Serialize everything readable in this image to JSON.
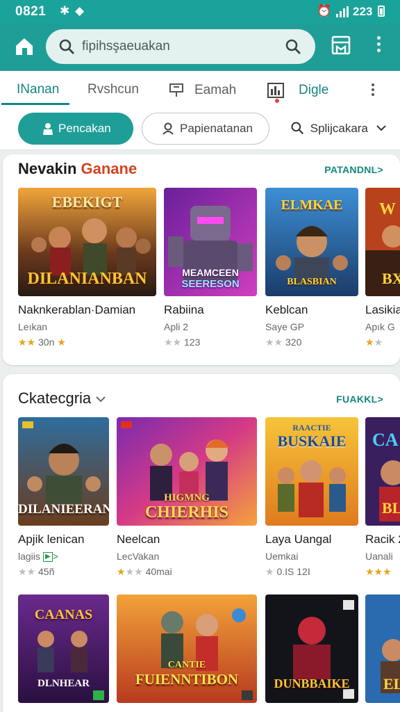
{
  "status_bar": {
    "time": "0821",
    "battery_text": "2̶2̶3̶",
    "battery": "223"
  },
  "search": {
    "placeholder": "fipihsşaeuakan"
  },
  "tabs": [
    {
      "label": "INanan",
      "active": true
    },
    {
      "label": "Rvshcun"
    },
    {
      "label": "Eamah"
    },
    {
      "label": "Digle"
    }
  ],
  "filters": {
    "primary": "Pencakan",
    "secondary": "Papienatanan",
    "dropdown": "Splijcakara"
  },
  "section1": {
    "title_main": "Nevakin",
    "title_accent": "Ganane",
    "link": "PATANDNL>",
    "games": [
      {
        "name": "Naknkerablan·Damian",
        "sub": "Leıkan",
        "rating": "30n",
        "stars_on": 2,
        "art": "DILANIANBAN",
        "art_top": "EBEKIGT"
      },
      {
        "name": "Rabiina",
        "sub": "Apli 2",
        "rating": "123",
        "stars_on": 0,
        "art": "SEERESON",
        "art_top": "MEAMCEEN"
      },
      {
        "name": "Keblcan",
        "sub": "Saye GP",
        "rating": "320",
        "stars_on": 0,
        "art": "BLASBIAN",
        "art_top": "ELMKAE"
      },
      {
        "name": "Lasikia",
        "sub": "Apık G",
        "rating": "",
        "stars_on": 1,
        "art": "BX",
        "art_top": "W"
      }
    ]
  },
  "section2": {
    "title": "Ckatecgria",
    "link": "FUAKKL>",
    "games": [
      {
        "name": "Apjik lenican",
        "sub": "lagiis",
        "rating": "45ñ",
        "stars_on": 0,
        "art": "DILANIEERAN",
        "art_top": ""
      },
      {
        "name": "Neelcan",
        "sub": "LecVakan",
        "rating": "40mai",
        "stars_on": 1,
        "art": "CHIERHIS",
        "art_top": "HIGMNG"
      },
      {
        "name": "Laya Uangal",
        "sub": "Uemkai",
        "rating": "0.IS 12I",
        "stars_on": 1,
        "art": "BUSKAIE",
        "art_top": "RAACTIE"
      },
      {
        "name": "Racik 2",
        "sub": "Uanali",
        "rating": "",
        "stars_on": 3,
        "art": "BL",
        "art_top": "CA"
      }
    ],
    "row2_games": [
      {
        "art": "DLNHEAR",
        "art_top": "CAANAS"
      },
      {
        "art": "FUIENNTIBON",
        "art_top": "CANTIE"
      },
      {
        "art": "DUNBBAIKE",
        "art_top": ""
      },
      {
        "art": "EL",
        "art_top": ""
      }
    ]
  }
}
